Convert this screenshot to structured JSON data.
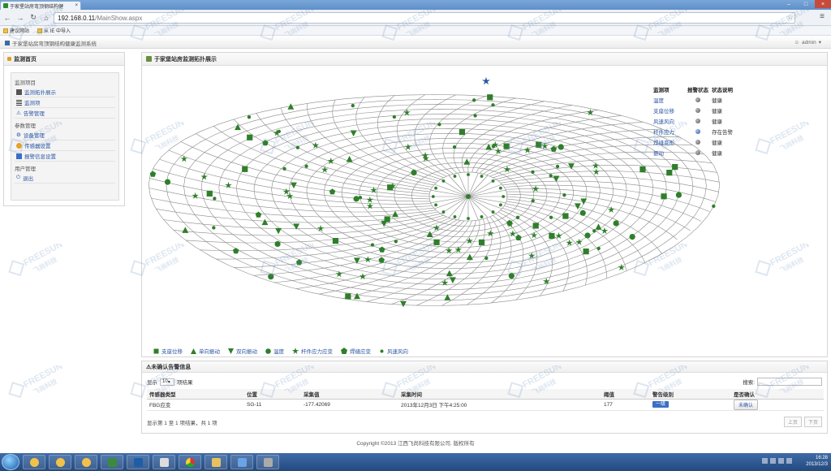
{
  "browser": {
    "tab_title": "于家堡站房弯顶钢结构健",
    "url_host": "192.168.0.11",
    "url_path": "/MainShow.aspx",
    "bookmarks": [
      "建议网站",
      "从 IE 中导入"
    ]
  },
  "app": {
    "title": "于家堡站房弯顶钢结构健康监测系统",
    "user": "admin"
  },
  "sidebar": {
    "title": "监测首页",
    "groups": [
      {
        "label": "监测项目",
        "items": [
          "监测拓扑展示",
          "监测项",
          "告警管理"
        ]
      },
      {
        "label": "参数管理",
        "items": [
          "设备管理",
          "传感器设置",
          "报警信息设置"
        ]
      },
      {
        "label": "用户管理",
        "items": [
          "退出"
        ]
      }
    ]
  },
  "main": {
    "title": "于家堡站房监测拓扑展示",
    "status_table": {
      "headers": [
        "监测项",
        "报警状态",
        "状态说明"
      ],
      "rows": [
        {
          "name": "温度",
          "state": "normal",
          "desc": "健康"
        },
        {
          "name": "支座位移",
          "state": "normal",
          "desc": "健康"
        },
        {
          "name": "风速风向",
          "state": "normal",
          "desc": "健康"
        },
        {
          "name": "杆件应力",
          "state": "alarm",
          "desc": "存在告警"
        },
        {
          "name": "焊缝变形",
          "state": "normal",
          "desc": "健康"
        },
        {
          "name": "振动",
          "state": "normal",
          "desc": "健康"
        }
      ]
    },
    "legend": [
      "支座位移",
      "单向振动",
      "双向振动",
      "温度",
      "杆件应力应变",
      "焊缝应变",
      "风速风向"
    ]
  },
  "alarms": {
    "title": "未确认告警信息",
    "show_prefix": "显示",
    "page_size": "10",
    "show_suffix": "项结果",
    "search_label": "搜索:",
    "columns": [
      "传感器类型",
      "位置",
      "采集值",
      "采集时间",
      "阈值",
      "警告级别",
      "是否确认"
    ],
    "rows": [
      {
        "type": "FBG应变",
        "position": "SG-11",
        "value": "-177.42069",
        "time": "2013年12月3日 下午4:25:00",
        "threshold": "177",
        "level": "一级",
        "confirm": "未确认"
      }
    ],
    "footer": "显示第 1 至 1 项结果，共 1 项",
    "pager": [
      "上页",
      "下页"
    ]
  },
  "copyright": "Copyright ©2013 江西飞尚科技有限公司. 版权所有",
  "taskbar": {
    "time": "16:28",
    "date": "2013/12/3"
  },
  "watermark": {
    "en": "FREESUN",
    "cn": "飞尚科技"
  },
  "colors": {
    "marker": "#2f7f2a",
    "link": "#2a55a5",
    "alarm": "#2a55a5",
    "taskbar": "#2d5a95"
  }
}
